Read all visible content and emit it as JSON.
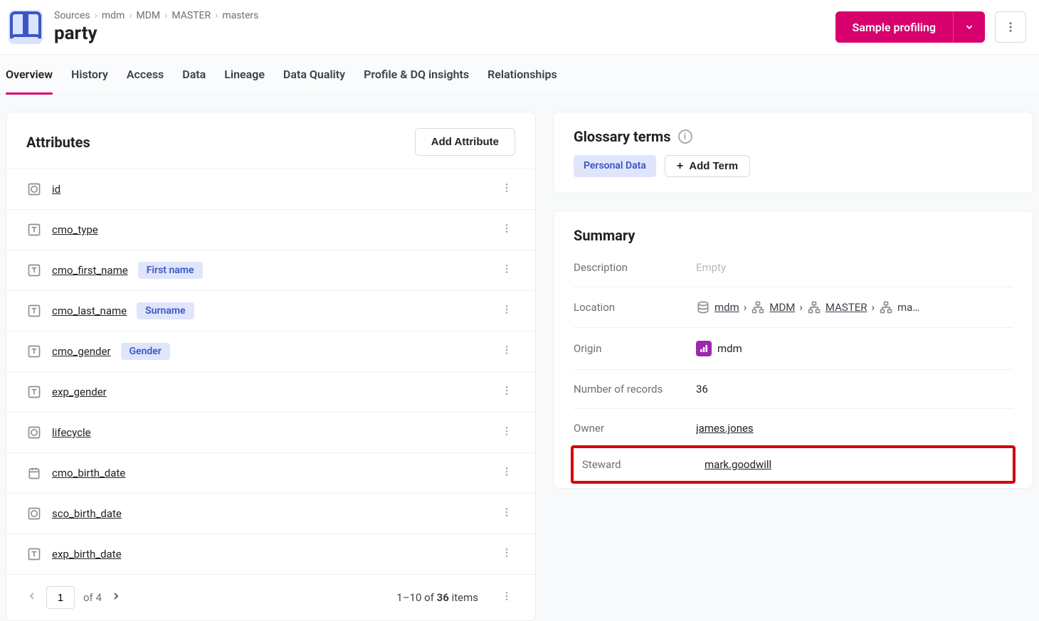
{
  "breadcrumb": [
    "Sources",
    "mdm",
    "MDM",
    "MASTER",
    "masters"
  ],
  "page_title": "party",
  "action_button": "Sample profiling",
  "tabs": [
    "Overview",
    "History",
    "Access",
    "Data",
    "Lineage",
    "Data Quality",
    "Profile & DQ insights",
    "Relationships"
  ],
  "active_tab": 0,
  "attributes": {
    "title": "Attributes",
    "add_btn": "Add Attribute",
    "rows": [
      {
        "icon": "O",
        "name": "id",
        "tag": null
      },
      {
        "icon": "T",
        "name": "cmo_type",
        "tag": null
      },
      {
        "icon": "T",
        "name": "cmo_first_name",
        "tag": "First name"
      },
      {
        "icon": "T",
        "name": "cmo_last_name",
        "tag": "Surname"
      },
      {
        "icon": "T",
        "name": "cmo_gender",
        "tag": "Gender"
      },
      {
        "icon": "T",
        "name": "exp_gender",
        "tag": null
      },
      {
        "icon": "O",
        "name": "lifecycle",
        "tag": null
      },
      {
        "icon": "D",
        "name": "cmo_birth_date",
        "tag": null
      },
      {
        "icon": "O",
        "name": "sco_birth_date",
        "tag": null
      },
      {
        "icon": "T",
        "name": "exp_birth_date",
        "tag": null
      }
    ],
    "pager": {
      "page": "1",
      "of": "of 4",
      "count_prefix": "1–10",
      "count_mid": " of ",
      "count_total": "36",
      "count_suffix": " items"
    }
  },
  "glossary": {
    "title": "Glossary terms",
    "tag": "Personal Data",
    "add_btn": "Add Term"
  },
  "summary": {
    "title": "Summary",
    "rows": {
      "description": {
        "label": "Description",
        "value": "Empty"
      },
      "location": {
        "label": "Location",
        "chain": [
          "mdm",
          "MDM",
          "MASTER",
          "ma…"
        ]
      },
      "origin": {
        "label": "Origin",
        "value": "mdm"
      },
      "records": {
        "label": "Number of records",
        "value": "36"
      },
      "owner": {
        "label": "Owner",
        "value": "james.jones"
      },
      "steward": {
        "label": "Steward",
        "value": "mark.goodwill"
      }
    }
  }
}
